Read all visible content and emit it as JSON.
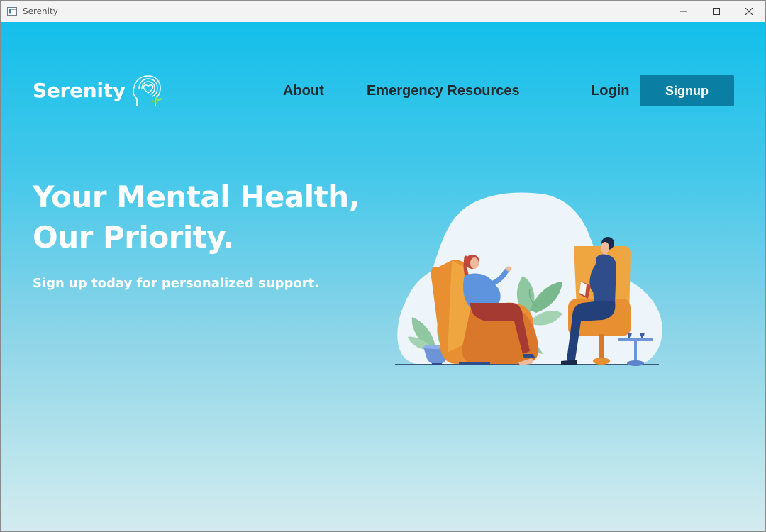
{
  "window": {
    "title": "Serenity",
    "icon": "app-window-icon",
    "controls": [
      "minimize-icon",
      "maximize-icon",
      "close-icon"
    ]
  },
  "logo": {
    "text": "Serenity",
    "icon": "mind-heart-head-icon"
  },
  "nav": {
    "about": "About",
    "emergency": "Emergency Resources",
    "login": "Login",
    "signup": "Signup"
  },
  "hero": {
    "headline_line1": "Your Mental Health,",
    "headline_line2": "Our Priority.",
    "subtext": "Sign up today for personalized support.",
    "illustration": "therapy-session-illustration"
  },
  "colors": {
    "accent": "#0a7fa3",
    "gradient_top": "#13bfea",
    "gradient_bottom": "#d4ebef",
    "text_light": "#ffffff",
    "text_dark": "#222a30"
  }
}
